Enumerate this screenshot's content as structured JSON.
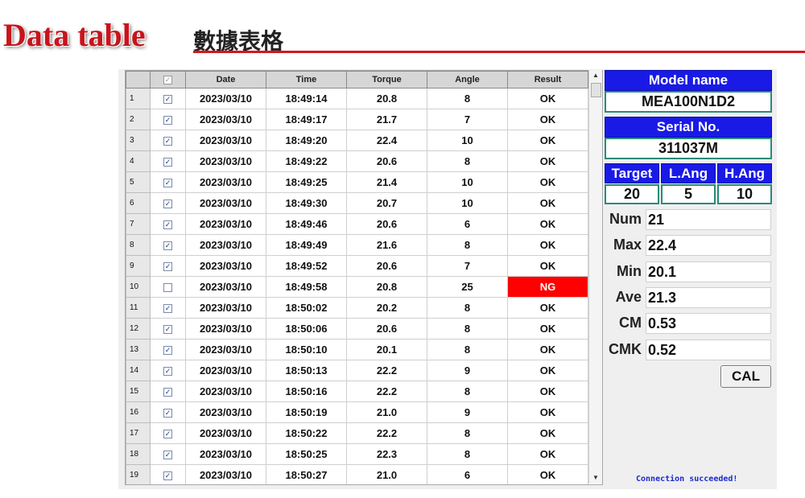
{
  "header": {
    "title": "Data table",
    "subtitle": "數據表格"
  },
  "table": {
    "columns": [
      "Date",
      "Time",
      "Torque",
      "Angle",
      "Result"
    ],
    "header_check": "✓",
    "rows": [
      {
        "n": "1",
        "check": "✓",
        "date": "2023/03/10",
        "time": "18:49:14",
        "torque": "20.8",
        "angle": "8",
        "result": "OK"
      },
      {
        "n": "2",
        "check": "✓",
        "date": "2023/03/10",
        "time": "18:49:17",
        "torque": "21.7",
        "angle": "7",
        "result": "OK"
      },
      {
        "n": "3",
        "check": "✓",
        "date": "2023/03/10",
        "time": "18:49:20",
        "torque": "22.4",
        "angle": "10",
        "result": "OK"
      },
      {
        "n": "4",
        "check": "✓",
        "date": "2023/03/10",
        "time": "18:49:22",
        "torque": "20.6",
        "angle": "8",
        "result": "OK"
      },
      {
        "n": "5",
        "check": "✓",
        "date": "2023/03/10",
        "time": "18:49:25",
        "torque": "21.4",
        "angle": "10",
        "result": "OK"
      },
      {
        "n": "6",
        "check": "✓",
        "date": "2023/03/10",
        "time": "18:49:30",
        "torque": "20.7",
        "angle": "10",
        "result": "OK"
      },
      {
        "n": "7",
        "check": "✓",
        "date": "2023/03/10",
        "time": "18:49:46",
        "torque": "20.6",
        "angle": "6",
        "result": "OK"
      },
      {
        "n": "8",
        "check": "✓",
        "date": "2023/03/10",
        "time": "18:49:49",
        "torque": "21.6",
        "angle": "8",
        "result": "OK"
      },
      {
        "n": "9",
        "check": "✓",
        "date": "2023/03/10",
        "time": "18:49:52",
        "torque": "20.6",
        "angle": "7",
        "result": "OK"
      },
      {
        "n": "10",
        "check": "",
        "date": "2023/03/10",
        "time": "18:49:58",
        "torque": "20.8",
        "angle": "25",
        "result": "NG"
      },
      {
        "n": "11",
        "check": "✓",
        "date": "2023/03/10",
        "time": "18:50:02",
        "torque": "20.2",
        "angle": "8",
        "result": "OK"
      },
      {
        "n": "12",
        "check": "✓",
        "date": "2023/03/10",
        "time": "18:50:06",
        "torque": "20.6",
        "angle": "8",
        "result": "OK"
      },
      {
        "n": "13",
        "check": "✓",
        "date": "2023/03/10",
        "time": "18:50:10",
        "torque": "20.1",
        "angle": "8",
        "result": "OK"
      },
      {
        "n": "14",
        "check": "✓",
        "date": "2023/03/10",
        "time": "18:50:13",
        "torque": "22.2",
        "angle": "9",
        "result": "OK"
      },
      {
        "n": "15",
        "check": "✓",
        "date": "2023/03/10",
        "time": "18:50:16",
        "torque": "22.2",
        "angle": "8",
        "result": "OK"
      },
      {
        "n": "16",
        "check": "✓",
        "date": "2023/03/10",
        "time": "18:50:19",
        "torque": "21.0",
        "angle": "9",
        "result": "OK"
      },
      {
        "n": "17",
        "check": "✓",
        "date": "2023/03/10",
        "time": "18:50:22",
        "torque": "22.2",
        "angle": "8",
        "result": "OK"
      },
      {
        "n": "18",
        "check": "✓",
        "date": "2023/03/10",
        "time": "18:50:25",
        "torque": "22.3",
        "angle": "8",
        "result": "OK"
      },
      {
        "n": "19",
        "check": "✓",
        "date": "2023/03/10",
        "time": "18:50:27",
        "torque": "21.0",
        "angle": "6",
        "result": "OK"
      }
    ]
  },
  "side": {
    "model_label": "Model name",
    "model_value": "MEA100N1D2",
    "serial_label": "Serial No.",
    "serial_value": "311037M",
    "target_label": "Target",
    "lang_label": "L.Ang",
    "hang_label": "H.Ang",
    "target_value": "20",
    "lang_value": "5",
    "hang_value": "10"
  },
  "stats": [
    {
      "label": "Num",
      "value": "21"
    },
    {
      "label": "Max",
      "value": "22.4"
    },
    {
      "label": "Min",
      "value": "20.1"
    },
    {
      "label": "Ave",
      "value": "21.3"
    },
    {
      "label": "CM",
      "value": "0.53"
    },
    {
      "label": "CMK",
      "value": "0.52"
    }
  ],
  "buttons": {
    "cal": "CAL"
  },
  "status_text": "Connection succeeded!",
  "scrollbar": {
    "up_icon": "▲",
    "down_icon": "▼"
  },
  "colors": {
    "title_red": "#c8141c",
    "panel_blue": "#1a1ae6",
    "ng_red": "#ff0000",
    "status_blue": "#1a2ad0"
  }
}
